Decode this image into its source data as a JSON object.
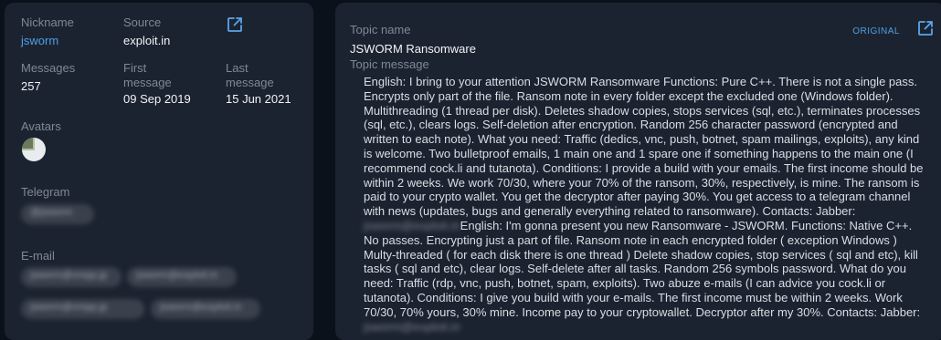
{
  "profile": {
    "nickname_label": "Nickname",
    "nickname": "jsworm",
    "source_label": "Source",
    "source": "exploit.in",
    "messages_label": "Messages",
    "messages": "257",
    "first_message_label": "First message",
    "first_message": "09 Sep 2019",
    "last_message_label": "Last message",
    "last_message": "15 Jun 2021",
    "avatars_label": "Avatars",
    "telegram_label": "Telegram",
    "telegram": "@jsworm",
    "email_label": "E-mail",
    "emails": [
      "jsworm@xmpp.jp",
      "jsworm@exploit.in",
      "jsworm@xmpp.jp",
      "jsworm@exploit.in"
    ]
  },
  "topic": {
    "name_label": "Topic name",
    "original_link": "ORIGINAL",
    "name": "JSWORM Ransomware",
    "message_label": "Topic message",
    "body_part1": "English: I bring to your attention JSWORM Ransomware Functions: Pure C++. There is not a single pass. Encrypts only part of the file. Ransom note in every folder except the excluded one (Windows folder). Multithreading (1 thread per disk). Deletes shadow copies, stops services (sql, etc.), terminates processes (sql, etc.), clears logs. Self-deletion after encryption. Random 256 character password (encrypted and written to each note). What you need: Traffic (dedics, vnc, push, botnet, spam mailings, exploits), any kind is welcome. Two bulletproof emails, 1 main one and 1 spare one if something happens to the main one (I recommend cock.li and tutanota). Conditions: I provide a build with your emails. The first income should be within 2 weeks. We work 70/30, where your 70% of the ransom, 30%, respectively, is mine. The ransom is paid to your crypto wallet. You get the decryptor after paying 30%. You get access to a telegram channel with news (updates, bugs and generally everything related to ransomware). Contacts: Jabber:",
    "redacted_1": "jsworm@exploit.in",
    "body_part2": "English: I'm gonna present you new Ransomware - JSWORM. Functions: Native C++. No passes. Encrypting just a part of file. Ransom note in each encrypted folder ( exception Windows ) Multy-threaded ( for each disk there is one thread ) Delete shadow copies, stop services ( sql and etc), kill tasks ( sql and etc), clear logs. Self-delete after all tasks. Random 256 symbols password. What do you need: Traffic (rdp, vnc, push, botnet, spam, exploits). Two abuze e-mails (I can advice you cock.li or tutanota). Conditions: I give you build with your e-mails. The first income must be within 2 weeks. Work 70/30, 70% yours, 30% mine. Income pay to your cryptowallet. Decryptor after my 30%. Contacts: Jabber:",
    "redacted_2": "jsworm@exploit.in"
  },
  "icons": {
    "source_external": "external-link-icon",
    "topic_external": "external-link-icon"
  },
  "colors": {
    "background": "#0b111b",
    "panel": "#1c2330",
    "accent": "#4d9fe6",
    "label": "#7f8895"
  }
}
